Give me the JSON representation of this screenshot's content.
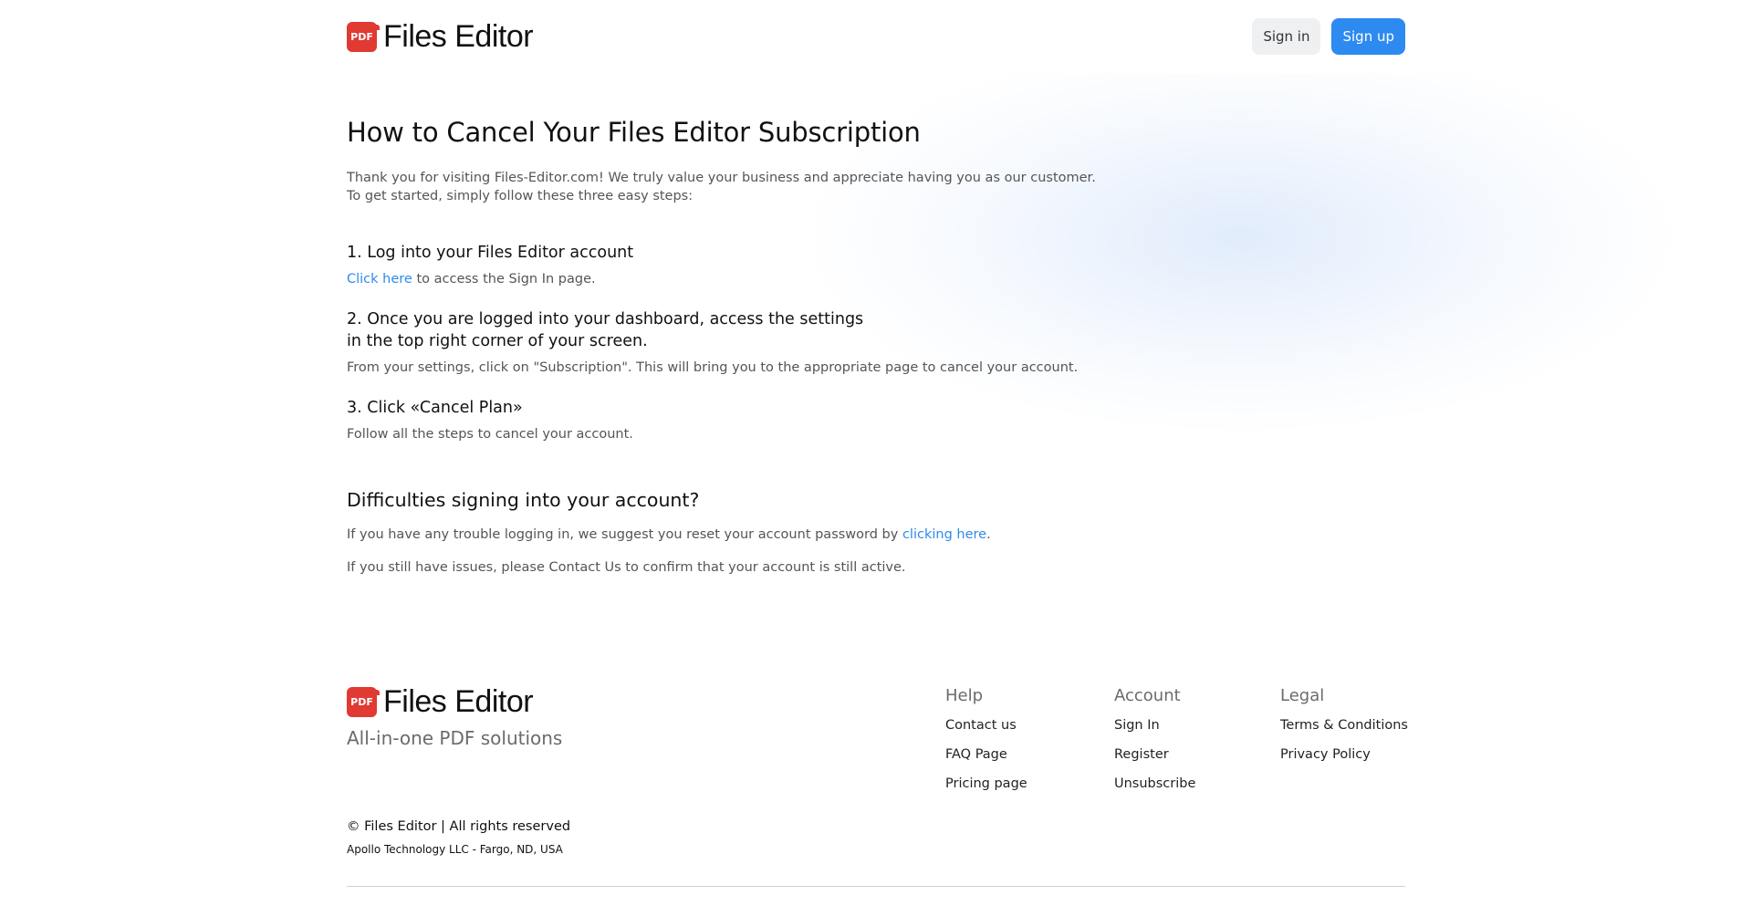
{
  "header": {
    "logo_badge": "PDF",
    "logo_text": "Files Editor",
    "signin_label": "Sign in",
    "signup_label": "Sign up"
  },
  "main": {
    "title": "How to Cancel Your Files Editor Subscription",
    "intro_line1": "Thank you for visiting Files-Editor.com! We truly value your business and appreciate having you as our customer.",
    "intro_line2": "To get started, simply follow these three easy steps:",
    "step1_title": "1. Log into your Files Editor account",
    "step1_link": "Click here",
    "step1_text": " to access the Sign In page.",
    "step2_title_line1": "2. Once you are logged into your dashboard, access the settings",
    "step2_title_line2": "in the top right corner of your screen.",
    "step2_text": "From your settings, click on \"Subscription\". This will bring you to the appropriate page to cancel your account.",
    "step3_title": "3. Click «Cancel Plan»",
    "step3_text": "Follow all the steps to cancel your account.",
    "difficulties_title": "Difficulties signing into your account?",
    "difficulties_text1": "If you have any trouble logging in, we suggest you reset your account password by ",
    "difficulties_link": "clicking here",
    "difficulties_text1_end": ".",
    "difficulties_text2": "If you still have issues, please Contact Us to confirm that your account is still active."
  },
  "footer": {
    "logo_badge": "PDF",
    "logo_text": "Files Editor",
    "tagline": "All-in-one PDF solutions",
    "help": {
      "title": "Help",
      "links": [
        "Contact us",
        "FAQ Page",
        "Pricing page"
      ]
    },
    "account": {
      "title": "Account",
      "links": [
        "Sign In",
        "Register",
        "Unsubscribe"
      ]
    },
    "legal": {
      "title": "Legal",
      "links": [
        "Terms & Conditions",
        "Privacy Policy"
      ]
    },
    "copyright": "© Files Editor | All rights reserved",
    "address": "Apollo Technology LLC - Fargo, ND, USA"
  },
  "colors": {
    "accent": "#2d8af0",
    "logo_red": "#e03a33"
  }
}
